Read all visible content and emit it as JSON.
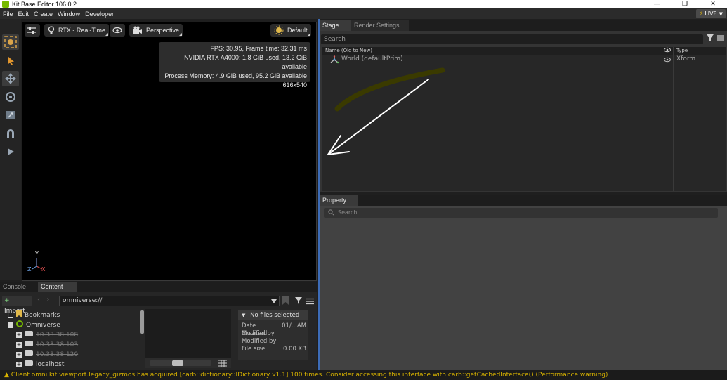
{
  "window": {
    "title": "Kit Base Editor 106.0.2",
    "minimize": "—",
    "restore": "❐",
    "close": "✕"
  },
  "menu": {
    "items": [
      "File",
      "Edit",
      "Create",
      "Window",
      "Developer"
    ],
    "live_label": "LIVE"
  },
  "viewport": {
    "render_mode": "RTX - Real-Time",
    "camera": "Perspective",
    "lighting": "Default",
    "stats": {
      "fps": "FPS: 30.95, Frame time: 32.31 ms",
      "gpu": "NVIDIA RTX A4000: 1.8 GiB used, 13.2 GiB available",
      "memory": "Process Memory: 4.9 GiB used, 95.2 GiB available",
      "resolution": "616x540"
    },
    "axis": {
      "y": "Y",
      "z": "Z",
      "x": "X"
    }
  },
  "stage": {
    "tabs": [
      "Stage",
      "Render Settings"
    ],
    "search_placeholder": "Search",
    "columns": {
      "name": "Name (Old to New)",
      "type": "Type"
    },
    "rows": [
      {
        "name": "World (defaultPrim)",
        "type": "Xform"
      }
    ]
  },
  "property": {
    "tab": "Property",
    "search_placeholder": "Search"
  },
  "bottom": {
    "tabs": [
      "Console",
      "Content"
    ],
    "import_label": "Import",
    "path": "omniverse://",
    "tree": [
      {
        "label": "Bookmarks",
        "expander": "■"
      },
      {
        "label": "Omniverse",
        "expander": "−"
      },
      {
        "label": "10.33.38.108",
        "expander": "+"
      },
      {
        "label": "10.33.38.103",
        "expander": "+"
      },
      {
        "label": "10.33.38.120",
        "expander": "+"
      },
      {
        "label": "localhost",
        "expander": "+"
      }
    ],
    "details": {
      "header": "No files selected",
      "date_modified_label": "Date Modified",
      "date_modified_value": "01/...AM",
      "created_by_label": "Created by",
      "modified_by_label": "Modified by",
      "file_size_label": "File size",
      "file_size_value": "0.00 KB"
    }
  },
  "status": {
    "message": "Client omni.kit.viewport.legacy_gizmos has acquired [carb::dictionary::IDictionary v1.1] 100 times. Consider accessing this interface with carb::getCachedInterface() (Performance warning)"
  },
  "colors": {
    "accent": "#3d6cb7",
    "brand": "#76b900",
    "warning": "#d6b100"
  }
}
